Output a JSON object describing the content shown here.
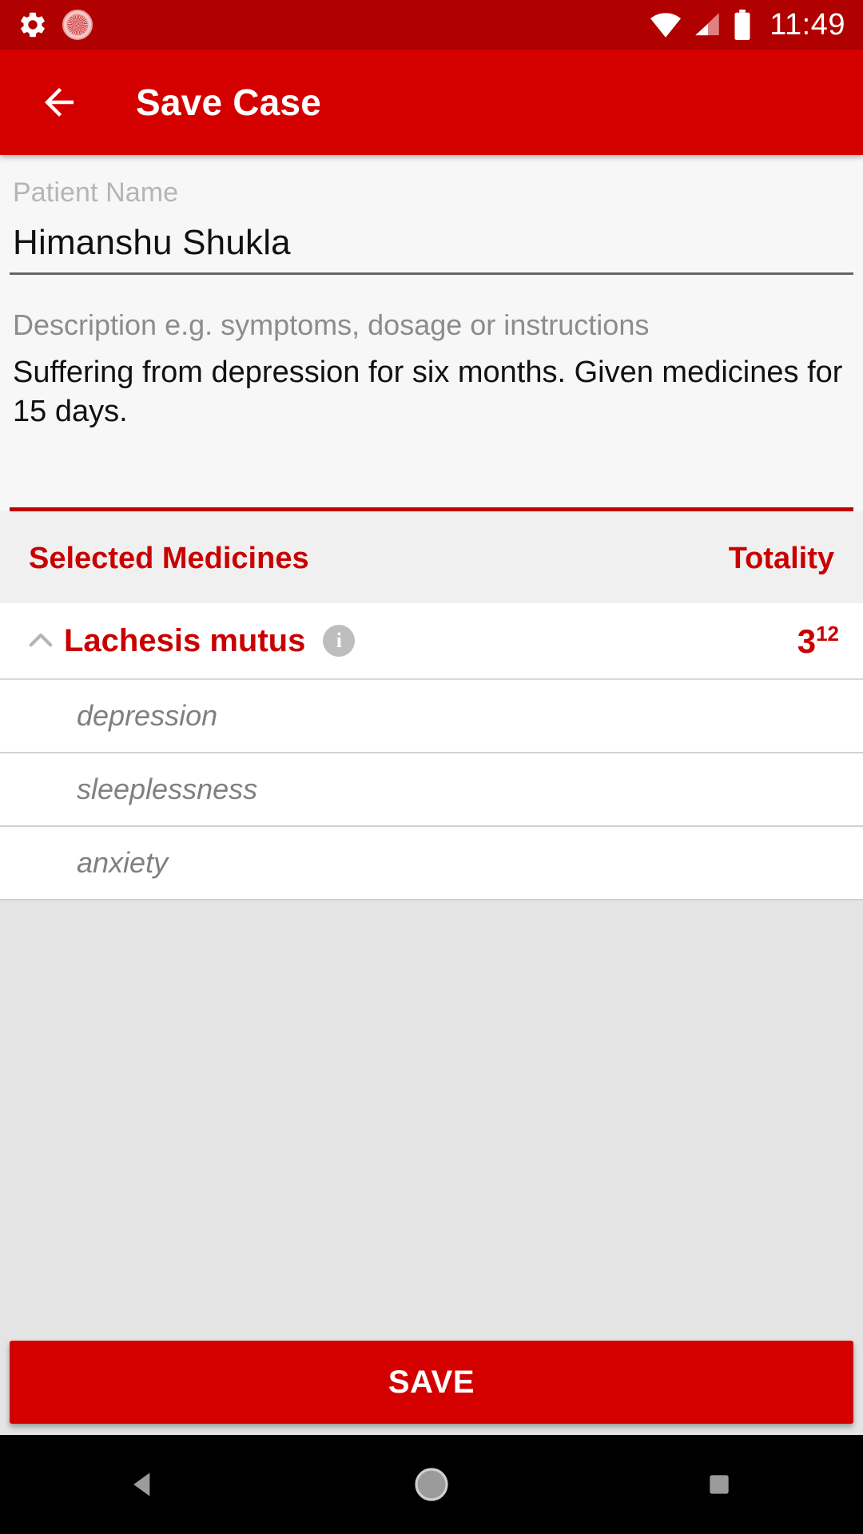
{
  "status_bar": {
    "icons_left": [
      "gear-icon",
      "app-badge-icon"
    ],
    "icons_right": [
      "wifi-icon",
      "signal-icon",
      "battery-icon"
    ],
    "time": "11:49"
  },
  "app_bar": {
    "back_icon": "arrow-back-icon",
    "title": "Save Case"
  },
  "form": {
    "patient_name": {
      "label": "Patient Name",
      "value": "Himanshu Shukla"
    },
    "description": {
      "label": "Description e.g. symptoms, dosage or instructions",
      "value": "Suffering from depression for six months. Given medicines for 15 days."
    }
  },
  "medicines_section": {
    "header_left": "Selected Medicines",
    "header_right": "Totality",
    "items": [
      {
        "expand_icon": "chevron-up-icon",
        "name": "Lachesis mutus",
        "info_icon": "info-icon",
        "info_glyph": "i",
        "totality_base": "3",
        "totality_sup": "12",
        "symptoms": [
          "depression",
          "sleeplessness",
          "anxiety"
        ]
      }
    ]
  },
  "footer": {
    "save_label": "SAVE"
  },
  "nav_bar": {
    "back": "nav-back-icon",
    "home": "nav-home-icon",
    "recents": "nav-recents-icon"
  },
  "colors": {
    "status_bar": "#b00000",
    "app_bar": "#d40000",
    "accent_red": "#c90000",
    "divider_red": "#c10000",
    "page_bg": "#f7f7f7",
    "filler_bg": "#e4e4e4"
  }
}
